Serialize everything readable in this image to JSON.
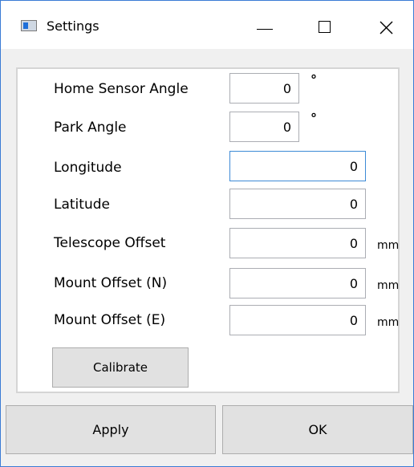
{
  "window": {
    "title": "Settings"
  },
  "icons": {
    "app": "app-window-icon",
    "minimize": "minimize-icon",
    "maximize": "maximize-icon",
    "close": "close-icon"
  },
  "fields": {
    "home_sensor_angle": {
      "label": "Home Sensor Angle",
      "value": "0",
      "unit": "°"
    },
    "park_angle": {
      "label": "Park Angle",
      "value": "0",
      "unit": "°"
    },
    "longitude": {
      "label": "Longitude",
      "value": "0"
    },
    "latitude": {
      "label": "Latitude",
      "value": "0"
    },
    "telescope_offset": {
      "label": "Telescope Offset",
      "value": "0",
      "unit": "mm"
    },
    "mount_offset_n": {
      "label": "Mount Offset (N)",
      "value": "0",
      "unit": "mm"
    },
    "mount_offset_e": {
      "label": "Mount Offset (E)",
      "value": "0",
      "unit": "mm"
    }
  },
  "buttons": {
    "calibrate": "Calibrate",
    "apply": "Apply",
    "ok": "OK"
  },
  "colors": {
    "window_border": "#3a7bd5",
    "focus_border": "#3c8ad6",
    "button_face": "#e1e1e1"
  }
}
